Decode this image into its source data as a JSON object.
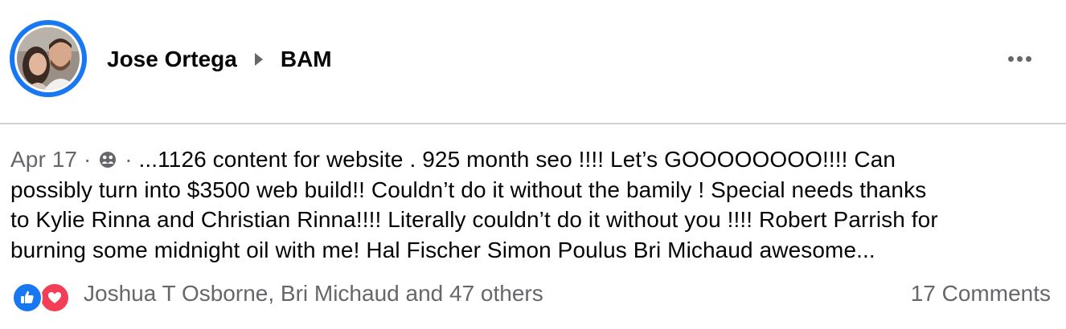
{
  "post": {
    "author": "Jose Ortega",
    "group": "BAM",
    "date": "Apr 17",
    "separator": "·",
    "privacy_icon": "friends-icon",
    "text_lines": [
      "...1126 content for website . 925 month seo !!!! Let’s GOOOOOOOO!!!! Can",
      "possibly turn into $3500 web build!! Couldn’t do it without the bamily ! Special needs thanks",
      "to Kylie Rinna and Christian Rinna!!!! Literally couldn’t do it without you !!!! Robert Parrish for",
      "burning some midnight oil with me! Hal Fischer Simon Poulus Bri Michaud awesome..."
    ],
    "reactors": "Joshua T Osborne, Bri Michaud and 47 others",
    "comments": "17 Comments",
    "more_icon": "more-options-icon"
  },
  "colors": {
    "accent": "#1877f2",
    "love": "#f33e58",
    "secondary_text": "#65676b",
    "divider": "#ced0d4"
  }
}
